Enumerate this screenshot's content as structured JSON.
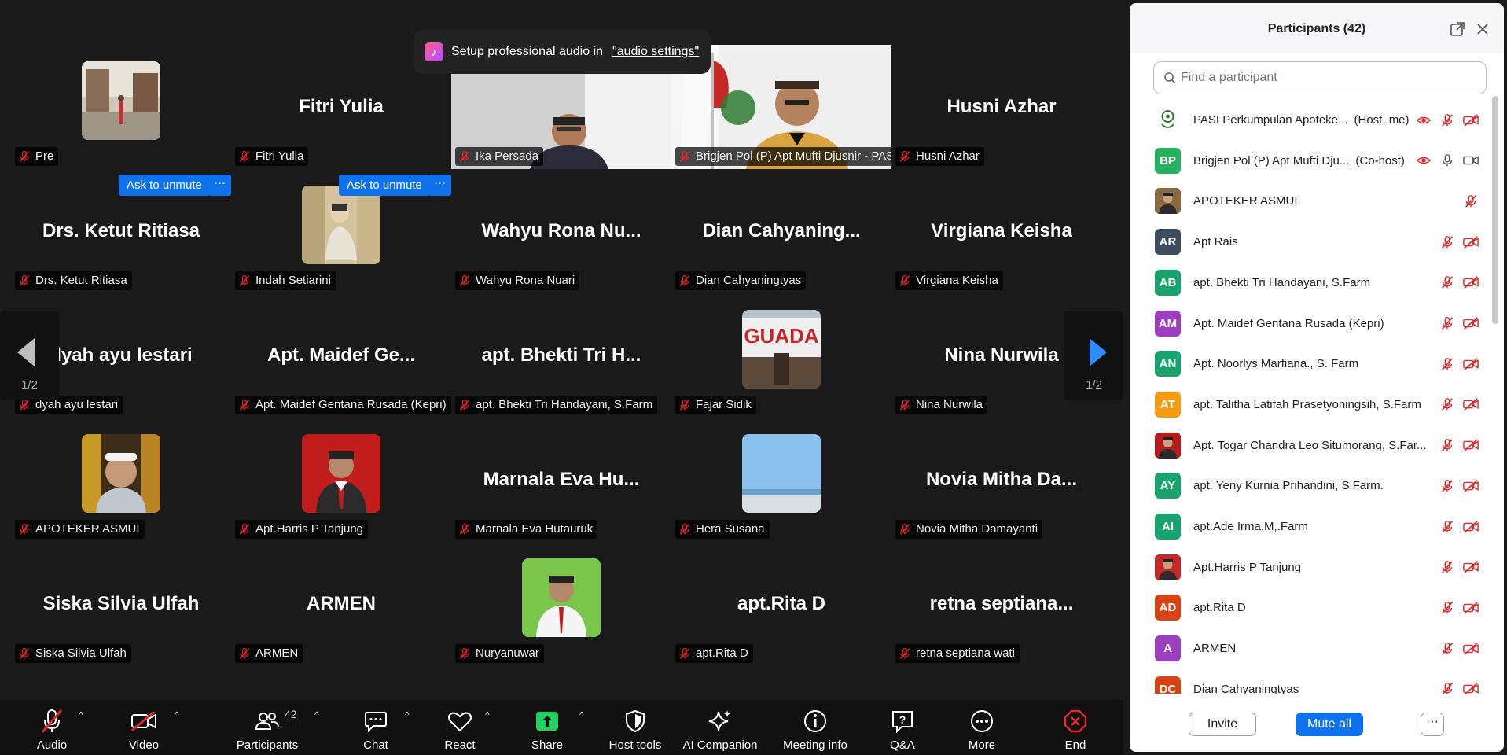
{
  "toast": {
    "text": "Setup professional audio in",
    "link": "\"audio settings\""
  },
  "page_indicator": {
    "prev": "1/2",
    "next": "1/2"
  },
  "ask_to_unmute": {
    "label": "Ask to unmute",
    "more": "···"
  },
  "tiles": [
    {
      "display": "",
      "label": "Pre",
      "kind": "photo-street"
    },
    {
      "display": "Fitri Yulia",
      "label": "Fitri Yulia",
      "kind": "name"
    },
    {
      "display": "",
      "label": "Ika Persada",
      "kind": "video-man"
    },
    {
      "display": "",
      "label": "Brigjen Pol (P) Apt Mufti Djusnir - PASI",
      "kind": "video-speaker"
    },
    {
      "display": "Husni Azhar",
      "label": "Husni Azhar",
      "kind": "name"
    },
    {
      "display": "Drs. Ketut Ritiasa",
      "label": "Drs. Ketut Ritiasa",
      "kind": "name"
    },
    {
      "display": "",
      "label": "Indah Setiarini",
      "kind": "photo-woman"
    },
    {
      "display": "Wahyu  Rona  Nu...",
      "label": "Wahyu Rona Nuari",
      "kind": "name"
    },
    {
      "display": "Dian  Cahyaning...",
      "label": "Dian Cahyaningtyas",
      "kind": "name"
    },
    {
      "display": "Virgiana Keisha",
      "label": "Virgiana Keisha",
      "kind": "name"
    },
    {
      "display": "dyah ayu lestari",
      "label": "dyah ayu lestari",
      "kind": "name"
    },
    {
      "display": "Apt.  Maidef  Ge...",
      "label": "Apt. Maidef Gentana Rusada (Kepri)",
      "kind": "name"
    },
    {
      "display": "apt.  Bhekti  Tri  H...",
      "label": "apt. Bhekti Tri Handayani, S.Farm",
      "kind": "name"
    },
    {
      "display": "",
      "label": "Fajar Sidik",
      "kind": "photo-sign"
    },
    {
      "display": "Nina Nurwila",
      "label": "Nina Nurwila",
      "kind": "name"
    },
    {
      "display": "",
      "label": "APOTEKER ASMUI",
      "kind": "photo-cap"
    },
    {
      "display": "",
      "label": "Apt.Harris P Tanjung",
      "kind": "photo-red"
    },
    {
      "display": "Marnala  Eva  Hu...",
      "label": "Marnala Eva Hutauruk",
      "kind": "name"
    },
    {
      "display": "",
      "label": "Hera Susana",
      "kind": "photo-sky"
    },
    {
      "display": "Novia  Mitha  Da...",
      "label": "Novia Mitha Damayanti",
      "kind": "name"
    },
    {
      "display": "Siska Silvia Ulfah",
      "label": "Siska Silvia Ulfah",
      "kind": "name"
    },
    {
      "display": "ARMEN",
      "label": "ARMEN",
      "kind": "name"
    },
    {
      "display": "",
      "label": "Nuryanuwar",
      "kind": "photo-green"
    },
    {
      "display": "apt.Rita D",
      "label": "apt.Rita D",
      "kind": "name"
    },
    {
      "display": "retna  septiana...",
      "label": "retna septiana wati",
      "kind": "name"
    }
  ],
  "toolbar": {
    "audio": "Audio",
    "video": "Video",
    "participants": "Participants",
    "participants_count": "42",
    "chat": "Chat",
    "react": "React",
    "share": "Share",
    "host_tools": "Host tools",
    "ai_companion": "AI Companion",
    "meeting_info": "Meeting info",
    "qa": "Q&A",
    "more": "More",
    "end": "End"
  },
  "panel": {
    "title": "Participants (42)",
    "search_placeholder": "Find a participant",
    "invite": "Invite",
    "mute_all": "Mute all",
    "more": "···"
  },
  "participants": [
    {
      "initials": "",
      "name": "PASI Perkumpulan Apoteke...",
      "role": "(Host, me)",
      "color": "#ffffff",
      "avatar": "logo",
      "icons": "host"
    },
    {
      "initials": "BP",
      "name": "Brigjen Pol (P) Apt Mufti Dju...",
      "role": "(Co-host)",
      "color": "#23b25e",
      "avatar": "initials",
      "icons": "cohost"
    },
    {
      "initials": "",
      "name": "APOTEKER ASMUI",
      "role": "",
      "color": "#8a6a40",
      "avatar": "photo",
      "icons": "mic-only"
    },
    {
      "initials": "AR",
      "name": "Apt Rais",
      "role": "",
      "color": "#3d4d5f",
      "avatar": "initials",
      "icons": "muted"
    },
    {
      "initials": "AB",
      "name": "apt. Bhekti Tri Handayani, S.Farm",
      "role": "",
      "color": "#17a36b",
      "avatar": "initials",
      "icons": "muted"
    },
    {
      "initials": "AM",
      "name": "Apt. Maidef Gentana Rusada (Kepri)",
      "role": "",
      "color": "#9b3fc0",
      "avatar": "initials",
      "icons": "muted"
    },
    {
      "initials": "AN",
      "name": "Apt. Noorlys Marfiana., S. Farm",
      "role": "",
      "color": "#17a36b",
      "avatar": "initials",
      "icons": "muted"
    },
    {
      "initials": "AT",
      "name": "apt. Talitha Latifah Prasetyoningsih, S.Farm",
      "role": "",
      "color": "#f39c12",
      "avatar": "initials",
      "icons": "muted"
    },
    {
      "initials": "",
      "name": "Apt. Togar Chandra Leo Situmorang, S.Far...",
      "role": "",
      "color": "#b71c1c",
      "avatar": "photo",
      "icons": "muted"
    },
    {
      "initials": "AY",
      "name": "apt. Yeny Kurnia Prihandini, S.Farm.",
      "role": "",
      "color": "#17a36b",
      "avatar": "initials",
      "icons": "muted"
    },
    {
      "initials": "AI",
      "name": "apt.Ade Irma.M,.Farm",
      "role": "",
      "color": "#17a36b",
      "avatar": "initials",
      "icons": "muted"
    },
    {
      "initials": "",
      "name": "Apt.Harris P Tanjung",
      "role": "",
      "color": "#c62828",
      "avatar": "photo",
      "icons": "muted"
    },
    {
      "initials": "AD",
      "name": "apt.Rita D",
      "role": "",
      "color": "#d84315",
      "avatar": "initials",
      "icons": "muted"
    },
    {
      "initials": "A",
      "name": "ARMEN",
      "role": "",
      "color": "#9b3fc0",
      "avatar": "initials",
      "icons": "muted"
    },
    {
      "initials": "DC",
      "name": "Dian Cahyaningtyas",
      "role": "",
      "color": "#d84315",
      "avatar": "initials",
      "icons": "muted"
    }
  ],
  "colors": {
    "accent": "#0e72ed",
    "active_speaker": "#23d160",
    "muted_red": "#e02828",
    "share_green": "#23d160"
  }
}
